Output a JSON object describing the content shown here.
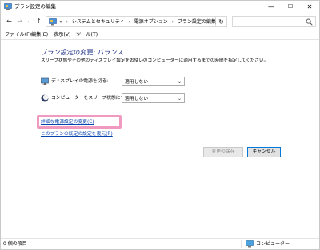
{
  "window": {
    "title": "プラン設定の編集",
    "controls": {
      "minimize": "—",
      "maximize": "☐",
      "close": "✕"
    }
  },
  "nav": {
    "back": "←",
    "forward": "→",
    "recent": "⌄",
    "up": "↑",
    "breadcrumb_prefix": "«",
    "breadcrumbs": [
      "システムとセキュリティ",
      "電源オプション",
      "プラン設定の編集"
    ],
    "breadcrumb_separator": "›",
    "address_dropdown": "⌄",
    "refresh": "↻",
    "search_placeholder": ""
  },
  "menu": {
    "items": [
      "ファイル(F)",
      "編集(E)",
      "表示(V)",
      "ツール(T)"
    ]
  },
  "main": {
    "heading": "プラン設定の変更: バランス",
    "description": "スリープ状態やその他のディスプレイ設定をお使いのコンピューターに適用するまでの時間を指定してください。",
    "settings": [
      {
        "label": "ディスプレイの電源を切る:",
        "value": "適用しない",
        "icon": "monitor-icon"
      },
      {
        "label": "コンピューターをスリープ状態にする:",
        "value": "適用しない",
        "icon": "moon-icon"
      }
    ],
    "select_arrow": "⌄",
    "links": {
      "advanced": "詳細な電源設定の変更(C)",
      "restore": "このプランの既定の設定を復元(R)"
    },
    "buttons": {
      "save": "変更の保存",
      "cancel": "キャンセル"
    },
    "colors": {
      "heading": "#1e3287",
      "link": "#0645ad",
      "highlight": "#f19ac0"
    }
  },
  "status": {
    "item_count": "0 個の項目",
    "location": "コンピューター"
  }
}
